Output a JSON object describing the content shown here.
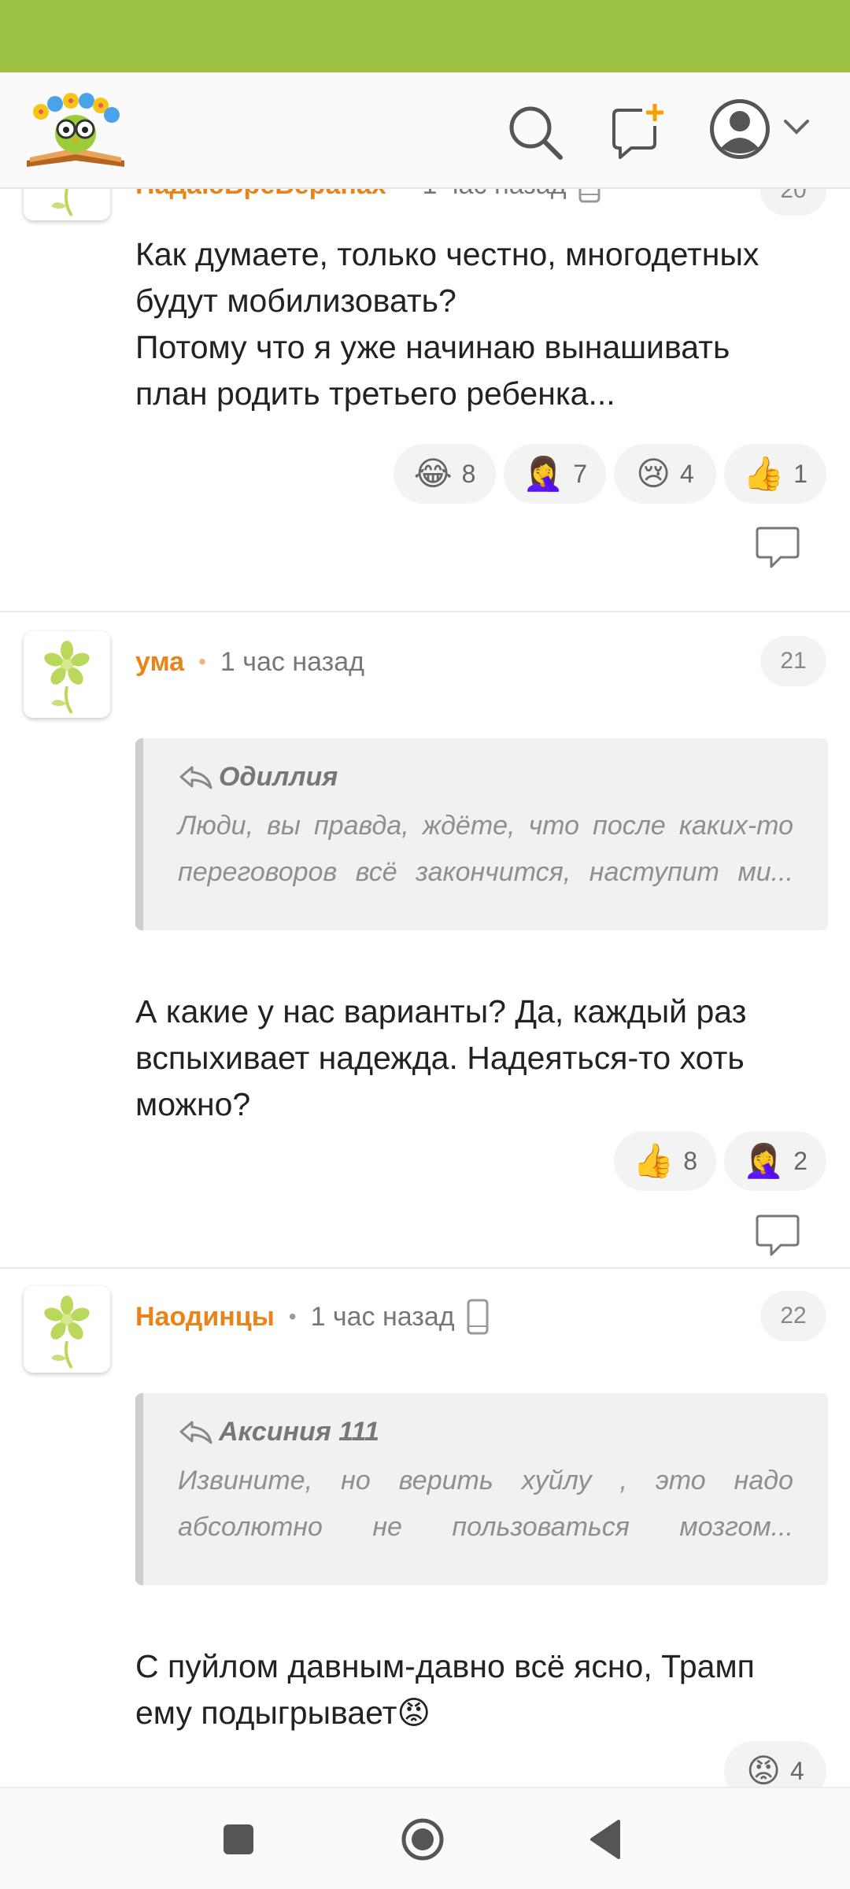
{
  "colors": {
    "status_bar": "#9dc143",
    "author": "#e8841a",
    "accent": "#f6a000"
  },
  "header": {
    "icons": [
      "logo-owl-books",
      "search-icon",
      "compose-plus-icon",
      "user-avatar-icon",
      "chevron-down-icon"
    ]
  },
  "comments": [
    {
      "author": "НадаюВреВеранах",
      "time": "1 час назад",
      "number": "20",
      "text_lines": [
        "Как думаете, только честно, многодетных",
        "будут мобилизовать?",
        "Потому что я уже начинаю вынашивать",
        "план родить третьего ребенка..."
      ],
      "reactions": [
        {
          "emoji": "😂",
          "count": "8"
        },
        {
          "emoji": "🤦‍♀️",
          "count": "7"
        },
        {
          "emoji": "😢",
          "count": "4"
        },
        {
          "emoji": "👍",
          "count": "1"
        }
      ]
    },
    {
      "author": "ума",
      "time": "1 час назад",
      "number": "21",
      "quote": {
        "author": "Одиллия",
        "lines": [
          "Люди, вы правда, ждёте, что после каких-то",
          "переговоров всё закончится, наступит ми..."
        ]
      },
      "text_lines": [
        "А какие у нас варианты? Да, каждый раз",
        "вспыхивает надежда. Надеяться-то хоть",
        "можно?"
      ],
      "reactions": [
        {
          "emoji": "👍",
          "count": "8"
        },
        {
          "emoji": "🤦‍♀️",
          "count": "2"
        }
      ]
    },
    {
      "author": "Наодинцы",
      "time": "1 час назад",
      "number": "22",
      "quote": {
        "author": "Аксиния 111",
        "lines": [
          "Извините, но верить хуйлу , это надо",
          "абсолютно не пользоваться мозгом..."
        ]
      },
      "text_lines": [
        "С пуйлом давным-давно всё ясно, Трамп",
        "ему подыгрывает😡"
      ],
      "reactions": [
        {
          "emoji": "😡",
          "count": "4"
        }
      ]
    }
  ],
  "nav": {
    "icons": [
      "recents-square-icon",
      "home-circle-icon",
      "back-triangle-icon"
    ]
  }
}
